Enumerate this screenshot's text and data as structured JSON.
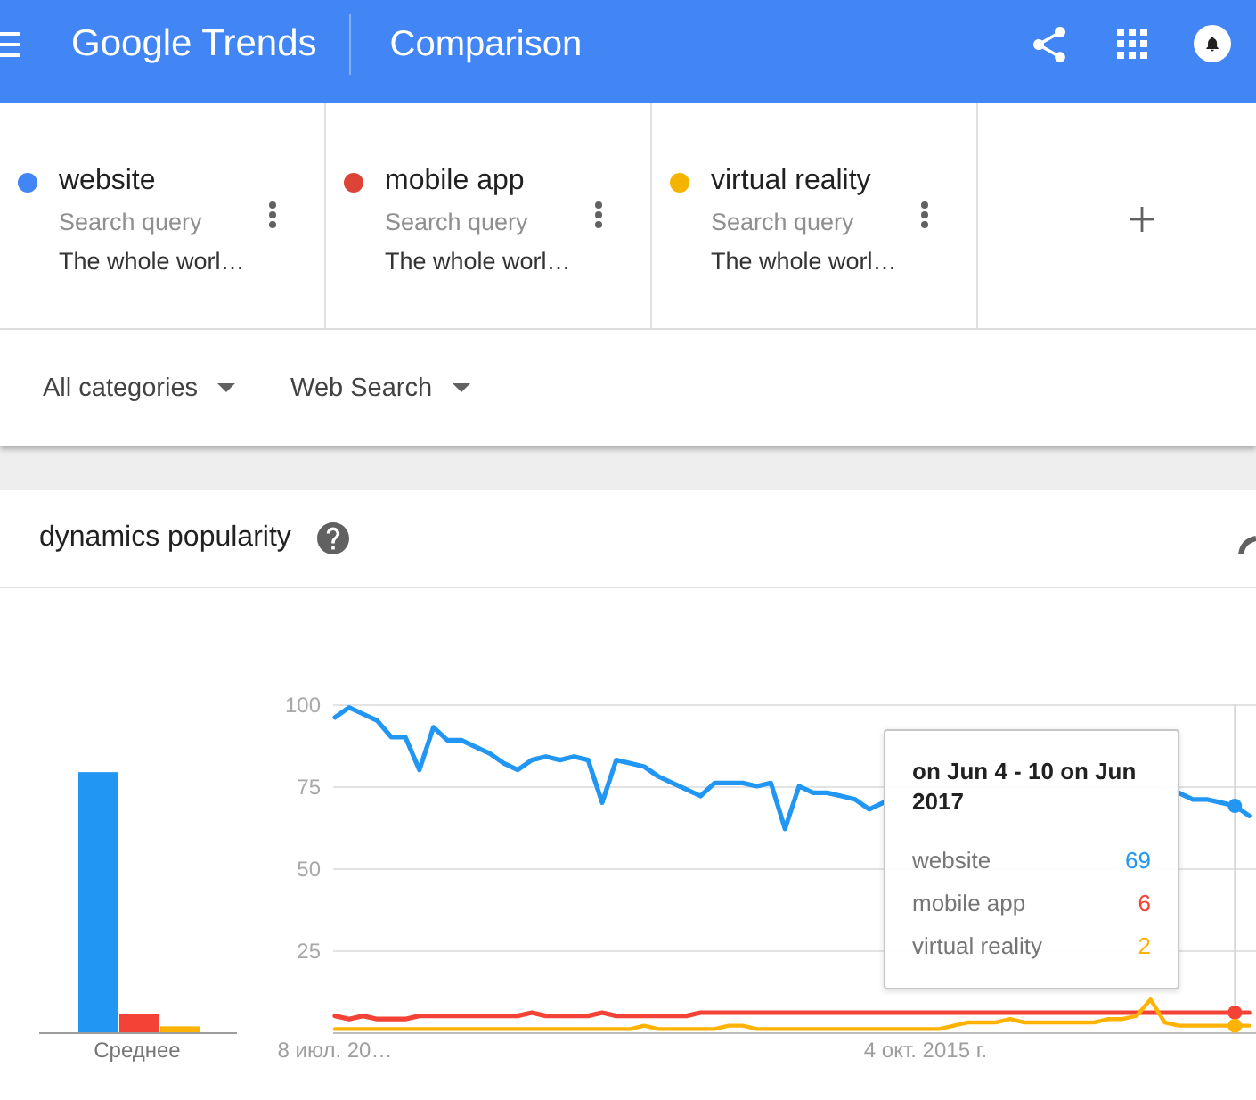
{
  "header": {
    "logo": "Google Trends",
    "title": "Comparison"
  },
  "queries": [
    {
      "term": "website",
      "query_type": "Search query",
      "region": "The whole worl…",
      "color": "#4285f4"
    },
    {
      "term": "mobile app",
      "query_type": "Search query",
      "region": "The whole worl…",
      "color": "#db4437"
    },
    {
      "term": "virtual reality",
      "query_type": "Search query",
      "region": "The whole worl…",
      "color": "#f4b400"
    }
  ],
  "filters": [
    {
      "label": "All categories"
    },
    {
      "label": "Web Search"
    }
  ],
  "panel": {
    "title": "dynamics popularity",
    "average_chart": {
      "label": "Среднее"
    },
    "chart_data": {
      "type": "line",
      "grid": true,
      "ylim": [
        0,
        100
      ],
      "yticks": [
        25,
        50,
        75,
        100
      ],
      "categories": [
        "8 июл. 20…",
        null,
        null,
        null,
        null,
        null,
        null,
        null,
        null,
        null,
        null,
        null,
        null,
        null,
        null,
        null,
        null,
        null,
        null,
        null,
        null,
        null,
        null,
        null,
        null,
        null,
        null,
        null,
        null,
        null,
        null,
        null,
        null,
        null,
        null,
        null,
        null,
        null,
        null,
        null,
        null,
        null,
        "4 окт. 2015 г.",
        null,
        null,
        null,
        null,
        null,
        null,
        null,
        null,
        null,
        null,
        null,
        null,
        null,
        null,
        null,
        null,
        null,
        null,
        null,
        null,
        null,
        null,
        null
      ],
      "series": [
        {
          "color": "#2196f3",
          "values": [
            96,
            99,
            97,
            95,
            90,
            90,
            80,
            93,
            89,
            89,
            87,
            85,
            82,
            80,
            83,
            84,
            83,
            84,
            83,
            70,
            83,
            82,
            81,
            78,
            76,
            74,
            72,
            76,
            76,
            76,
            75,
            76,
            62,
            75,
            73,
            73,
            72,
            71,
            68,
            70,
            null,
            null,
            null,
            null,
            null,
            null,
            null,
            null,
            null,
            null,
            null,
            null,
            null,
            null,
            null,
            null,
            null,
            null,
            null,
            null,
            73,
            71,
            71,
            70,
            69,
            66
          ]
        },
        {
          "color": "#f44336",
          "values": [
            5,
            4,
            5,
            4,
            4,
            4,
            5,
            5,
            5,
            5,
            5,
            5,
            5,
            5,
            6,
            5,
            5,
            5,
            5,
            6,
            5,
            5,
            5,
            5,
            5,
            5,
            6,
            6,
            6,
            6,
            6,
            6,
            6,
            6,
            6,
            6,
            6,
            6,
            6,
            6,
            6,
            6,
            6,
            6,
            6,
            6,
            6,
            6,
            6,
            6,
            6,
            6,
            6,
            6,
            6,
            6,
            6,
            6,
            6,
            6,
            6,
            6,
            6,
            6,
            6,
            6
          ]
        },
        {
          "color": "#ffb300",
          "values": [
            1,
            1,
            1,
            1,
            1,
            1,
            1,
            1,
            1,
            1,
            1,
            1,
            1,
            1,
            1,
            1,
            1,
            1,
            1,
            1,
            1,
            1,
            2,
            1,
            1,
            1,
            1,
            1,
            2,
            2,
            1,
            1,
            1,
            1,
            1,
            1,
            1,
            1,
            1,
            1,
            1,
            1,
            1,
            1,
            2,
            3,
            3,
            3,
            4,
            3,
            3,
            3,
            3,
            3,
            3,
            4,
            4,
            5,
            10,
            3,
            2,
            2,
            2,
            2,
            2,
            2
          ]
        }
      ]
    },
    "tooltip": {
      "title": "on Jun 4 - 10 on Jun 2017",
      "rows": [
        {
          "label": "website",
          "value": "69"
        },
        {
          "label": "mobile app",
          "value": "6"
        },
        {
          "label": "virtual reality",
          "value": "2"
        }
      ]
    }
  }
}
